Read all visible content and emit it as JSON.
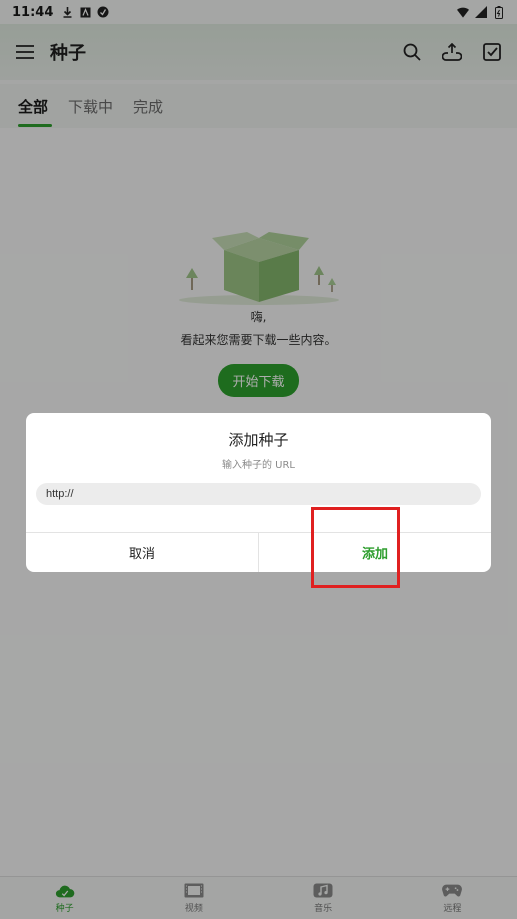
{
  "status": {
    "time": "11:44",
    "left_icons": [
      "download-icon",
      "square-a-icon",
      "circle-app-icon"
    ],
    "right_icons": [
      "wifi-icon",
      "signal-icon",
      "battery-icon"
    ]
  },
  "appbar": {
    "title": "种子",
    "menu_icon": "menu-icon",
    "actions": [
      "search-icon",
      "share-cloud-icon",
      "checkbox-icon"
    ]
  },
  "tabs": {
    "items": [
      {
        "label": "全部",
        "active": true
      },
      {
        "label": "下载中",
        "active": false
      },
      {
        "label": "完成",
        "active": false
      }
    ]
  },
  "empty": {
    "line1": "嗨,",
    "line2": "看起来您需要下载一些内容。",
    "button": "开始下载"
  },
  "dialog": {
    "title": "添加种子",
    "subtitle": "输入种子的 URL",
    "input_value": "http://",
    "cancel": "取消",
    "add": "添加"
  },
  "bottom_nav": {
    "items": [
      {
        "label": "种子",
        "icon": "seed-cloud-icon",
        "active": true
      },
      {
        "label": "视频",
        "icon": "film-icon",
        "active": false
      },
      {
        "label": "音乐",
        "icon": "music-icon",
        "active": false
      },
      {
        "label": "远程",
        "icon": "gamepad-icon",
        "active": false
      }
    ]
  },
  "colors": {
    "accent": "#2e9e2e",
    "highlight": "#e02020"
  }
}
